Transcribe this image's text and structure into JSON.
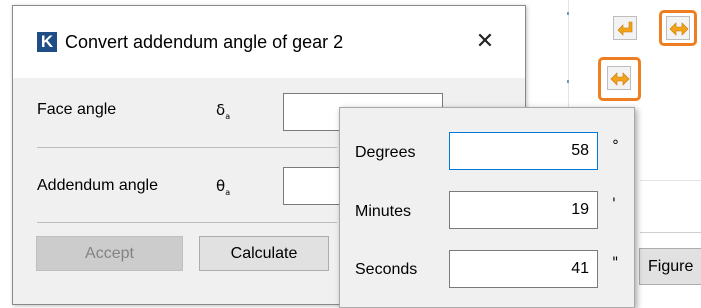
{
  "dialog": {
    "logo_letter": "K",
    "title": "Convert addendum angle of gear 2",
    "close_glyph": "✕",
    "fields": [
      {
        "label": "Face angle",
        "symbol": "δ",
        "symbol_sub": "a"
      },
      {
        "label": "Addendum angle",
        "symbol": "θ",
        "symbol_sub": "a"
      }
    ],
    "buttons": {
      "accept": "Accept",
      "calculate": "Calculate"
    }
  },
  "popup": {
    "rows": [
      {
        "label": "Degrees",
        "value": "58",
        "unit": "°"
      },
      {
        "label": "Minutes",
        "value": "19",
        "unit": "'"
      },
      {
        "label": "Seconds",
        "value": "41",
        "unit": "\""
      }
    ]
  },
  "background": {
    "figure_button": "Figure",
    "icons": [
      "return-arrow-icon",
      "double-arrow-icon",
      "double-arrow-icon"
    ],
    "colors": {
      "highlight": "#ef7d22",
      "arrow_fill": "#f3a21b",
      "logo_bg": "#1f4e86",
      "focus_border": "#0078d7"
    }
  }
}
